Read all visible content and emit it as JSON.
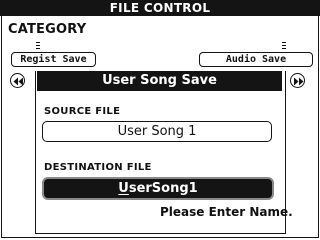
{
  "header": {
    "title": "FILE CONTROL"
  },
  "category": {
    "label": "CATEGORY",
    "left_tab": "Regist Save",
    "right_tab": "Audio Save"
  },
  "dialog": {
    "title": "User Song Save",
    "source_label": "SOURCE FILE",
    "source_value": "User Song 1",
    "destination_label": "DESTINATION FILE",
    "destination_cursor_char": "U",
    "destination_rest": "serSong1",
    "hint": "Please Enter Name."
  },
  "icons": {
    "left_nav": "rewind-icon",
    "right_nav": "fast-forward-icon"
  }
}
